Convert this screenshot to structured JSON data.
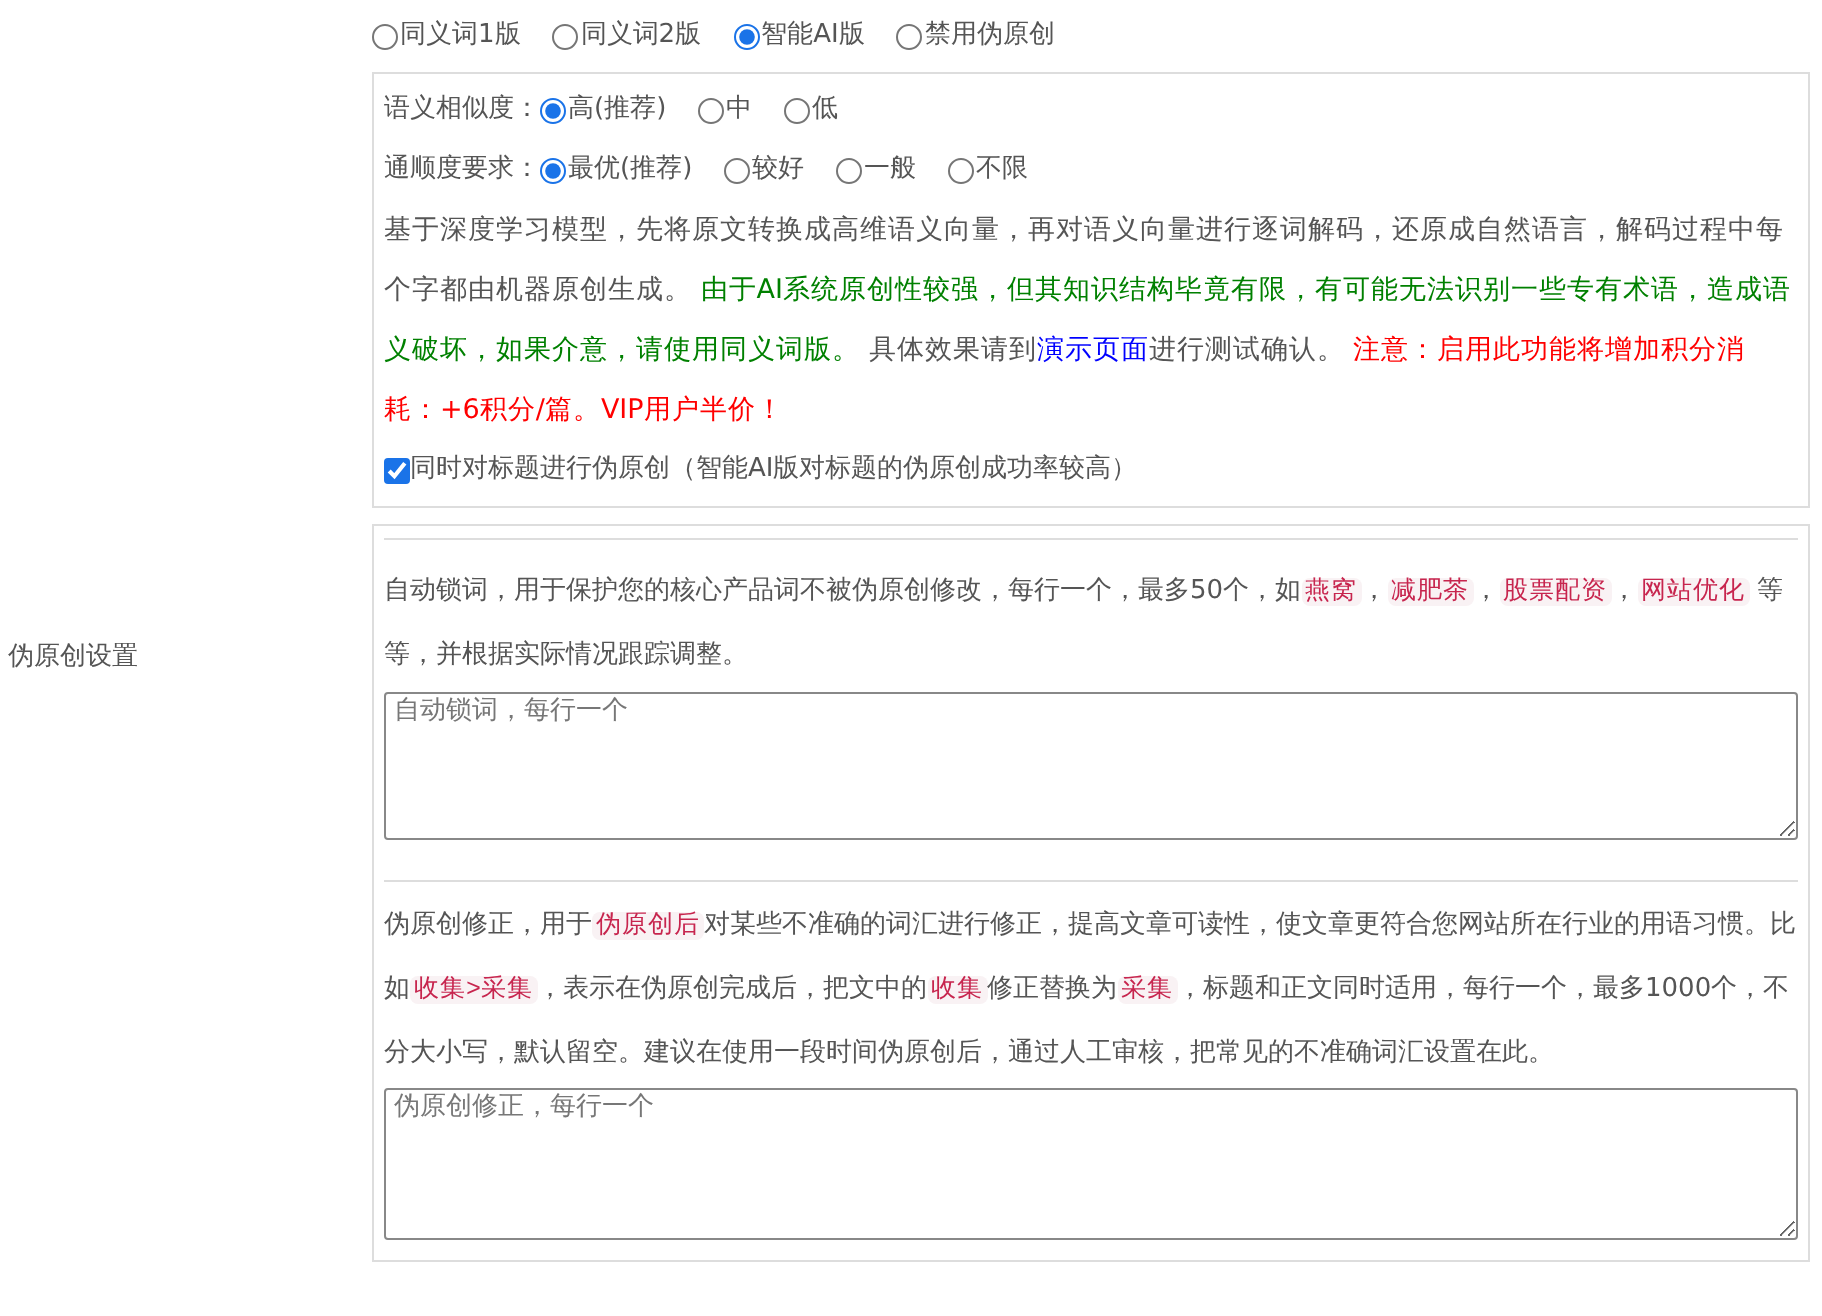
{
  "section_label": "伪原创设置",
  "modes": [
    {
      "label": "同义词1版",
      "selected": false
    },
    {
      "label": "同义词2版",
      "selected": false
    },
    {
      "label": "智能AI版",
      "selected": true
    },
    {
      "label": "禁用伪原创",
      "selected": false
    }
  ],
  "settings": [
    {
      "label": "语义相似度：",
      "options": [
        {
          "label": "高(推荐)",
          "selected": true
        },
        {
          "label": "中",
          "selected": false
        },
        {
          "label": "低",
          "selected": false
        }
      ]
    },
    {
      "label": "通顺度要求：",
      "options": [
        {
          "label": "最优(推荐)",
          "selected": true
        },
        {
          "label": "较好",
          "selected": false
        },
        {
          "label": "一般",
          "selected": false
        },
        {
          "label": "不限",
          "selected": false
        }
      ]
    }
  ],
  "description": [
    {
      "kind": "text",
      "text": "基于深度学习模型，先将原文转换成高维语义向量，再对语义向量进行逐词解码，还原成自然语言，解码过程中每个字都由机器原创生成。 "
    },
    {
      "kind": "note",
      "text": "由于AI系统原创性较强，但其知识结构毕竟有限，有可能无法识别一些专有术语，造成语义破坏，如果介意，请使用同义词版。"
    },
    {
      "kind": "text",
      "text": " 具体效果请到"
    },
    {
      "kind": "link",
      "text": "演示页面"
    },
    {
      "kind": "text",
      "text": "进行测试确认。 "
    },
    {
      "kind": "warning",
      "text": "注意：启用此功能将增加积分消耗：+6积分/篇。VIP用户半价！"
    }
  ],
  "title_option": {
    "label": "同时对标题进行伪原创（智能AI版对标题的伪原创成功率较高）",
    "checked": true
  },
  "lock_words": {
    "segments": [
      {
        "kind": "text",
        "text": "自动锁词，用于保护您的核心产品词不被伪原创修改，每行一个，最多50个，如"
      },
      {
        "kind": "tag",
        "text": "燕窝"
      },
      {
        "kind": "text",
        "text": "，"
      },
      {
        "kind": "tag",
        "text": "减肥茶"
      },
      {
        "kind": "text",
        "text": "，"
      },
      {
        "kind": "tag",
        "text": "股票配资"
      },
      {
        "kind": "text",
        "text": "，"
      },
      {
        "kind": "tag",
        "text": "网站优化"
      },
      {
        "kind": "text",
        "text": " 等等，并根据实际情况跟踪调整。"
      }
    ],
    "placeholder": "自动锁词，每行一个"
  },
  "correction": {
    "segments": [
      {
        "kind": "text",
        "text": "伪原创修正，用于"
      },
      {
        "kind": "tag",
        "text": "伪原创后"
      },
      {
        "kind": "text",
        "text": "对某些不准确的词汇进行修正，提高文章可读性，使文章更符合您网站所在行业的用语习惯。比如"
      },
      {
        "kind": "tag",
        "text": "收集>采集"
      },
      {
        "kind": "text",
        "text": "，表示在伪原创完成后，把文中的"
      },
      {
        "kind": "tag",
        "text": "收集"
      },
      {
        "kind": "text",
        "text": "修正替换为"
      },
      {
        "kind": "tag",
        "text": "采集"
      },
      {
        "kind": "text",
        "text": "，标题和正文同时适用，每行一个，最多1000个，不分大小写，默认留空。建议在使用一段时间伪原创后，通过人工审核，把常见的不准确词汇设置在此。"
      }
    ],
    "placeholder": "伪原创修正，每行一个"
  }
}
